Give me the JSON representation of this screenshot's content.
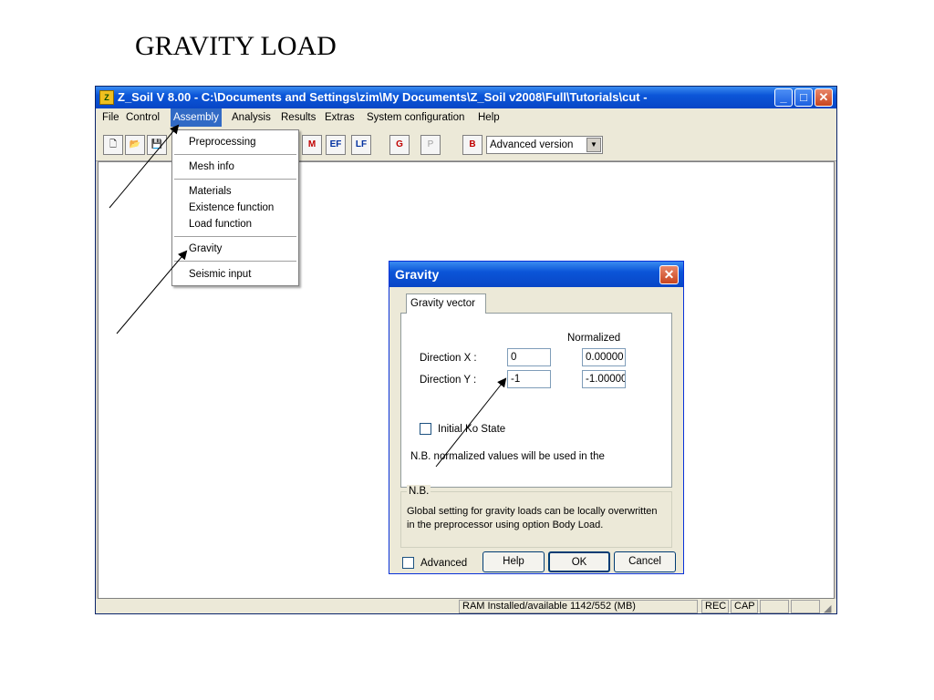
{
  "slide_title": "GRAVITY LOAD",
  "window": {
    "title": "Z_Soil V 8.00 - C:\\Documents and Settings\\zim\\My Documents\\Z_Soil v2008\\Full\\Tutorials\\cut -",
    "minimize_glyph": "_",
    "maximize_glyph": "□",
    "close_glyph": "✕",
    "app_icon_glyph": "Z"
  },
  "menubar": {
    "items": [
      "File",
      "Control",
      "Assembly",
      "Analysis",
      "Results",
      "Extras",
      "System configuration",
      "Help"
    ],
    "active": "Assembly"
  },
  "toolbar": {
    "tools": [
      {
        "icon": "new-file-icon",
        "glyph": "🗋"
      },
      {
        "icon": "open-folder-icon",
        "glyph": "📂"
      },
      {
        "icon": "save-icon",
        "glyph": "💾"
      },
      {
        "icon": "materials-icon",
        "glyph": "M"
      },
      {
        "icon": "existence-function-icon",
        "glyph": "EF"
      },
      {
        "icon": "load-function-icon",
        "glyph": "LF"
      },
      {
        "icon": "gravity-chart-icon",
        "glyph": "G"
      },
      {
        "icon": "postprocessor-icon",
        "glyph": "P"
      },
      {
        "icon": "version-icon",
        "glyph": "B"
      }
    ],
    "version_select": "Advanced version"
  },
  "assembly_menu": {
    "items": [
      "Preprocessing",
      "Mesh info",
      "Materials",
      "Existence function",
      "Load function",
      "Gravity",
      "Seismic input"
    ]
  },
  "statusbar": {
    "ram": "RAM Installed/available  1142/552 (MB)",
    "rec": "REC",
    "cap": "CAP"
  },
  "gravity_dialog": {
    "title": "Gravity",
    "tab": "Gravity vector",
    "normalized_header": "Normalized",
    "direction_x_label": "Direction X :",
    "direction_x_value": "0",
    "direction_x_normalized": "0.00000",
    "direction_y_label": "Direction Y :",
    "direction_y_value": "-1",
    "direction_y_normalized": "-1.00000",
    "initial_ko_label": "Initial Ko State",
    "initial_ko_checked": false,
    "note": "N.B. normalized values will be used in the",
    "group_legend": "N.B.",
    "group_text_line1": "Global setting for gravity loads can be locally overwritten",
    "group_text_line2": "in the preprocessor using option Body Load.",
    "advanced_label": "Advanced",
    "advanced_checked": false,
    "help_button": "Help",
    "ok_button": "OK",
    "cancel_button": "Cancel"
  }
}
